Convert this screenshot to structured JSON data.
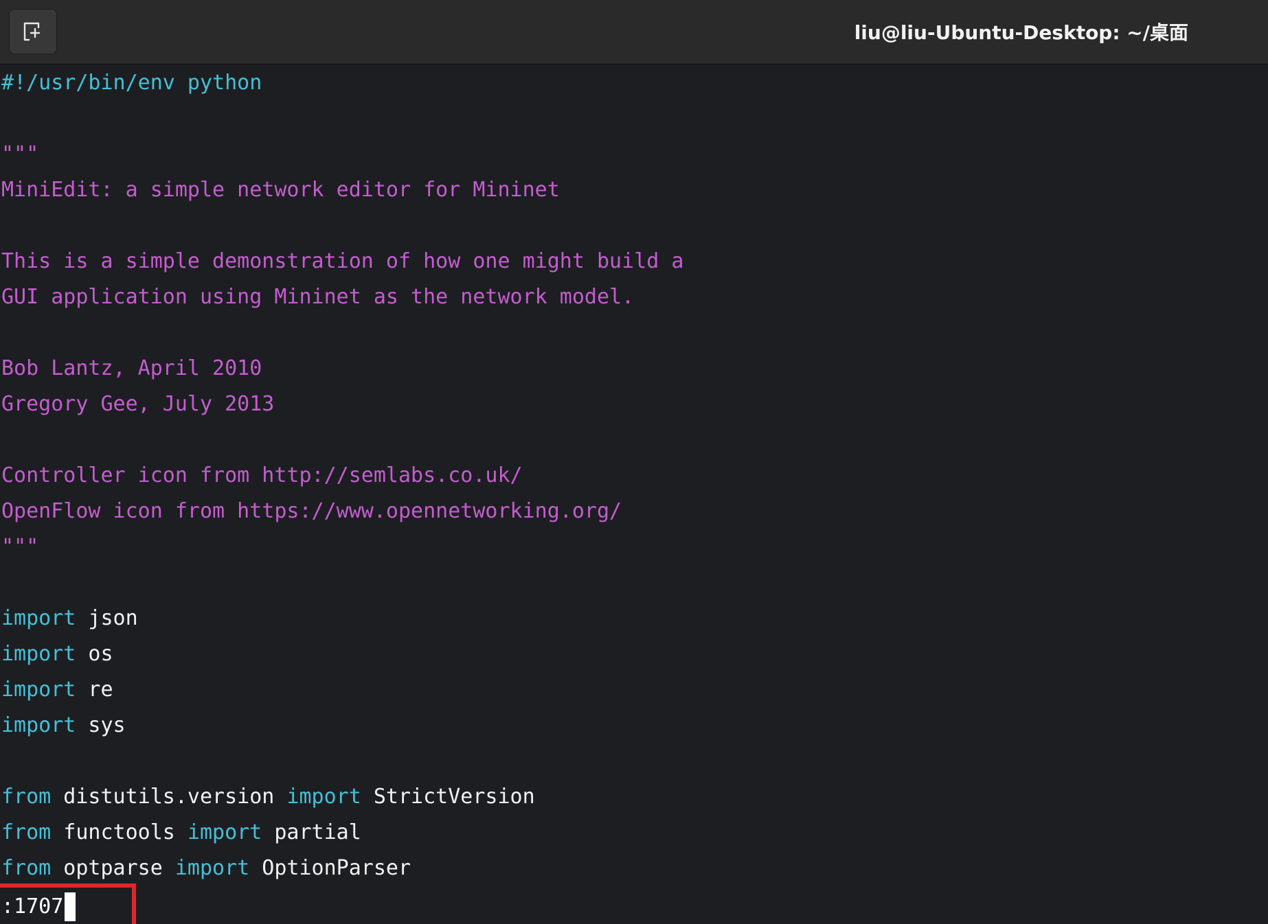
{
  "window": {
    "title": "liu@liu-Ubuntu-Desktop: ~/桌面",
    "new_tab_icon": "new-tab-icon"
  },
  "editor": {
    "lines": {
      "l1": "#!/usr/bin/env python",
      "l3": "\"\"\"",
      "l4": "MiniEdit: a simple network editor for Mininet",
      "l6": "This is a simple demonstration of how one might build a",
      "l7": "GUI application using Mininet as the network model.",
      "l9": "Bob Lantz, April 2010",
      "l10": "Gregory Gee, July 2013",
      "l12": "Controller icon from http://semlabs.co.uk/",
      "l13": "OpenFlow icon from https://www.opennetworking.org/",
      "l14": "\"\"\"",
      "l16_kw": "import",
      "l16_rest": " json",
      "l17_kw": "import",
      "l17_rest": " os",
      "l18_kw": "import",
      "l18_rest": " re",
      "l19_kw": "import",
      "l19_rest": " sys",
      "l21_kw1": "from",
      "l21_mid": " distutils.version ",
      "l21_kw2": "import",
      "l21_rest": " StrictVersion",
      "l22_kw1": "from",
      "l22_mid": " functools ",
      "l22_kw2": "import",
      "l22_rest": " partial",
      "l23_kw1": "from",
      "l23_mid": " optparse ",
      "l23_kw2": "import",
      "l23_rest": " OptionParser"
    }
  },
  "command_line": {
    "text": ":1707"
  },
  "colors": {
    "background": "#1d1e21",
    "keyword": "#43c0d8",
    "docstring": "#c45dd0",
    "plain": "#f2f2f2",
    "highlight_box": "#e2242b"
  }
}
